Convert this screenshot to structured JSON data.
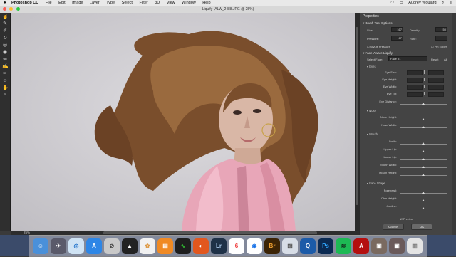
{
  "menubar": {
    "apple": "",
    "items": [
      "Photoshop CC",
      "File",
      "Edit",
      "Image",
      "Layer",
      "Type",
      "Select",
      "Filter",
      "3D",
      "View",
      "Window",
      "Help"
    ],
    "user": "Audrey Woulard"
  },
  "window": {
    "title": "Liquify (ALW_2488.JPG @ 25%)"
  },
  "status": {
    "zoom": "25%"
  },
  "panel": {
    "title": "Properties",
    "brush": {
      "header": "Brush Tool Options",
      "size_label": "Size:",
      "size_value": "167",
      "density_label": "Density:",
      "density_value": "50",
      "pressure_label": "Pressure:",
      "pressure_value": "67",
      "rate_label": "Rate:",
      "rate_value": "",
      "stylus_label": "Stylus Pressure",
      "pin_label": "Pin Edges"
    },
    "face": {
      "header": "Face-Aware Liquify",
      "select_label": "Select Face:",
      "select_value": "Face #1",
      "reset": "Reset",
      "all": "All"
    },
    "eyes": {
      "header": "Eyes",
      "rows": [
        "Eye Size:",
        "Eye Height:",
        "Eye Width:",
        "Eye Tilt:",
        "Eye Distance:"
      ]
    },
    "nose": {
      "header": "Nose",
      "rows": [
        "Nose Height:",
        "Nose Width:"
      ]
    },
    "mouth": {
      "header": "Mouth",
      "rows": [
        "Smile:",
        "Upper Lip:",
        "Lower Lip:",
        "Mouth Width:",
        "Mouth Height:"
      ]
    },
    "shape": {
      "header": "Face Shape",
      "rows": [
        "Forehead:",
        "Chin Height:",
        "Jawline:"
      ]
    },
    "preview": "Preview",
    "cancel": "Cancel",
    "ok": "OK"
  },
  "dock": [
    "Finder",
    "Launchpad",
    "Safari",
    "App Store",
    "Unknown",
    "Stocks",
    "Photos",
    "iBooks",
    "Activity Monitor",
    "Firefox",
    "Lightroom",
    "Calendar",
    "Chrome",
    "Bridge",
    "Preview",
    "QuickTime",
    "Photoshop",
    "Spotify",
    "Acrobat",
    "Photo",
    "Photo",
    "Trash"
  ],
  "colors": {
    "canvas_bg": "#cfcdd1",
    "panel_bg": "#444444",
    "dock_ps": "#0b2a52",
    "dock_lr": "#1f3147",
    "dock_br": "#3b2305"
  }
}
